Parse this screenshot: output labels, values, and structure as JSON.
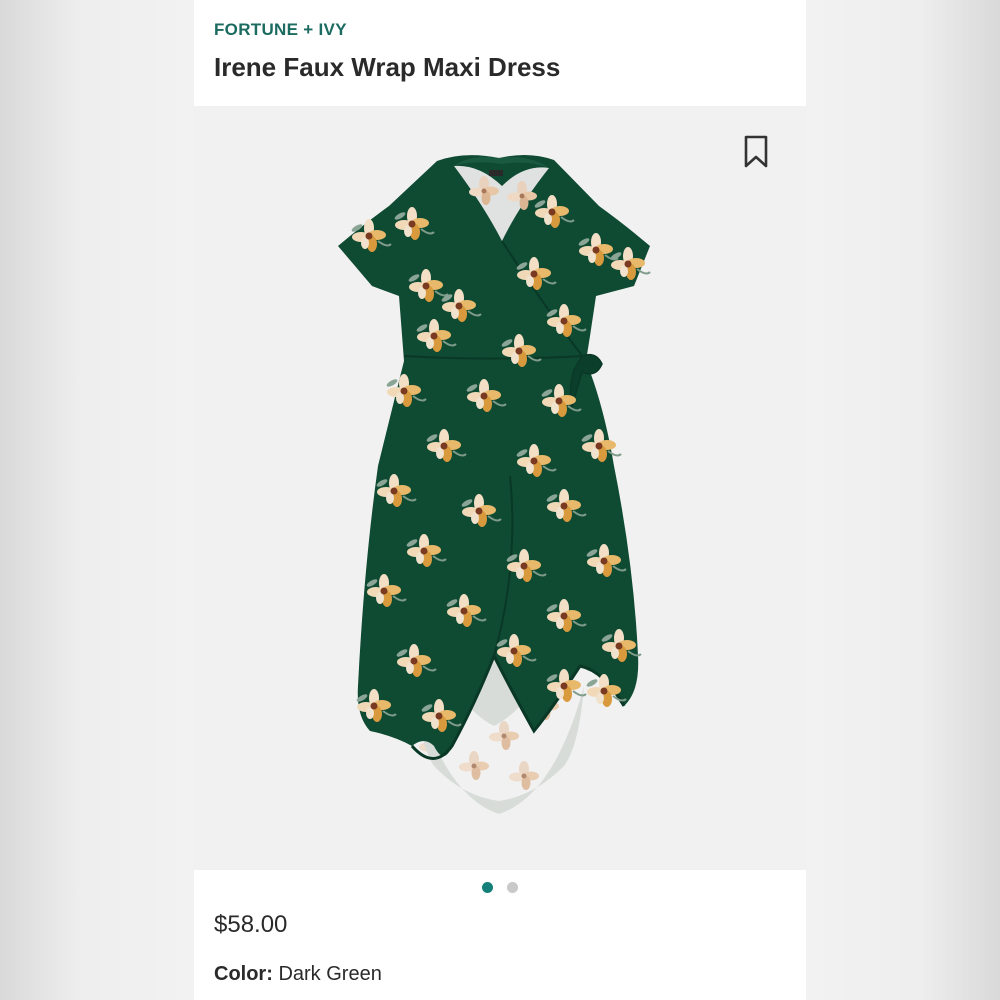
{
  "product": {
    "brand": "FORTUNE + IVY",
    "title": "Irene Faux Wrap Maxi Dress",
    "price": "$58.00",
    "color_label": "Color:",
    "color_value": "Dark Green"
  },
  "image": {
    "subject": "dress-image",
    "bookmark_icon": "bookmark-icon",
    "carousel": {
      "total": 2,
      "active_index": 0
    }
  },
  "colors": {
    "brand_accent": "#1b6b60",
    "dot_active": "#15807a",
    "dot_inactive": "#c9c9c9",
    "dress_green": "#0f4a33"
  }
}
